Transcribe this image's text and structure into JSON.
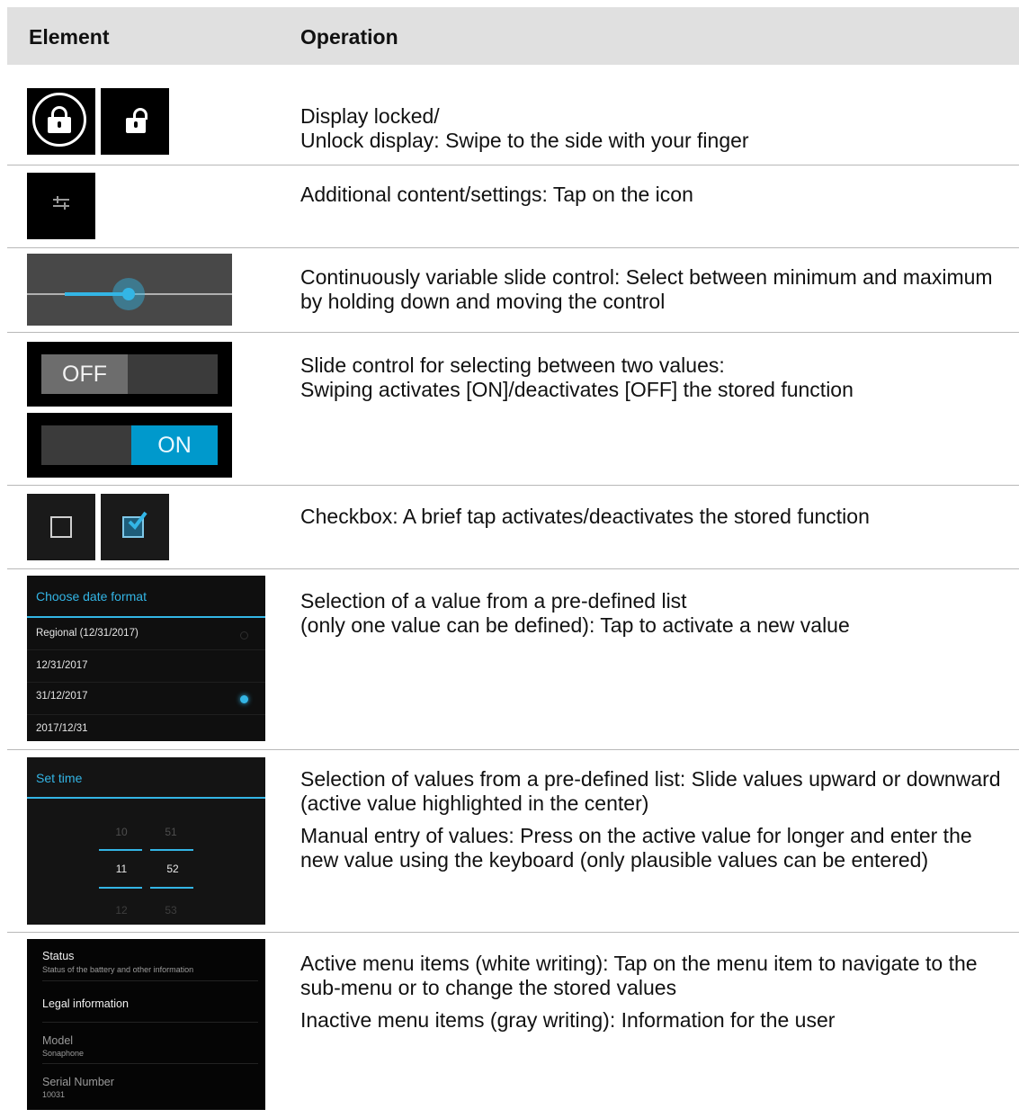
{
  "header": {
    "element": "Element",
    "operation": "Operation"
  },
  "rows": [
    {
      "operation": [
        "Display locked/",
        "Unlock display: Swipe to the side with your finger"
      ]
    },
    {
      "operation": [
        "Additional content/settings: Tap on the icon"
      ]
    },
    {
      "operation": [
        "Continuously variable slide control: Select between minimum and maximum by holding down and moving the control"
      ]
    },
    {
      "operation": [
        "Slide control for selecting between two values:",
        "Swiping activates [ON]/deactivates [OFF] the stored function"
      ]
    },
    {
      "operation": [
        "Checkbox: A brief tap activates/deactivates the stored function"
      ]
    },
    {
      "operation": [
        "Selection of a value from a pre-defined list",
        "(only one value can be defined): Tap to activate a new value"
      ]
    },
    {
      "operation": [
        "Selection of values from a pre-defined list: Slide values upward or downward (active value highlighted in the center)",
        "Manual entry of values: Press on the active value for longer and enter the new value using the keyboard (only plausible values can be entered)"
      ]
    },
    {
      "operation": [
        "Active menu items (white writing): Tap on the menu item to navigate to the sub-menu or to change the stored values",
        "Inactive menu items (gray writing): Information for the user"
      ]
    }
  ],
  "icons": {
    "row1": [
      "lock-closed-icon",
      "lock-open-icon"
    ],
    "row2": "settings-sliders-icon",
    "row5": [
      "checkbox-unchecked-icon",
      "checkbox-checked-icon"
    ]
  },
  "seekbar": {
    "level_percent": 40
  },
  "toggles": {
    "off_label": "OFF",
    "on_label": "ON"
  },
  "date_dialog": {
    "title": "Choose date format",
    "options": [
      "Regional (12/31/2017)",
      "12/31/2017",
      "31/12/2017",
      "2017/12/31"
    ],
    "selected_index": 2
  },
  "time_dialog": {
    "title": "Set time",
    "hours": [
      "10",
      "11",
      "12"
    ],
    "minutes": [
      "51",
      "52",
      "53"
    ],
    "active_hour": "11",
    "active_minute": "52"
  },
  "menu": {
    "items": [
      {
        "title": "Status",
        "subtitle": "Status of the battery and other information"
      },
      {
        "title": "Legal information",
        "subtitle": ""
      },
      {
        "title": "Model",
        "subtitle": "Sonaphone"
      },
      {
        "title": "Serial Number",
        "subtitle": "10031"
      }
    ]
  },
  "colors": {
    "accent": "#33b5e5",
    "header_bg": "#e0e0e0",
    "ui_black": "#000000",
    "rule": "#b8b8b8"
  }
}
